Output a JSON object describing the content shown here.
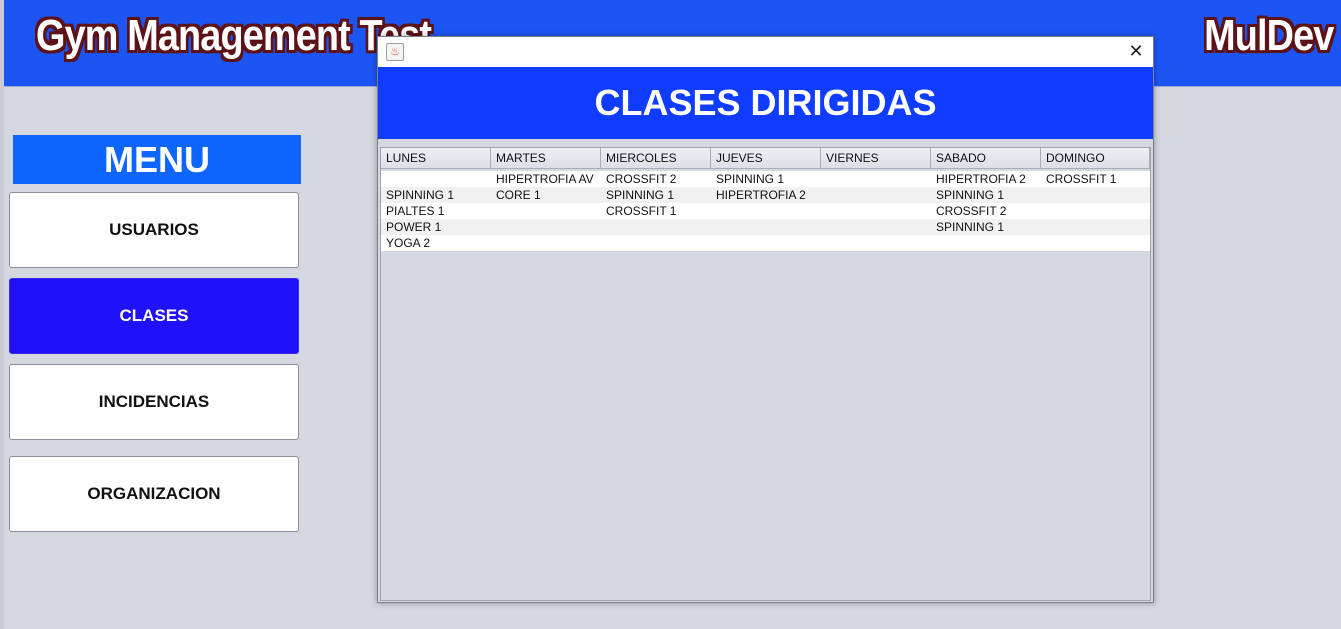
{
  "header": {
    "app_title": "Gym Management Test",
    "brand": "MulDev"
  },
  "sidebar": {
    "menu_title": "MENU",
    "items": [
      {
        "label": "USUARIOS",
        "active": false
      },
      {
        "label": "CLASES",
        "active": true
      },
      {
        "label": "INCIDENCIAS",
        "active": false
      },
      {
        "label": "ORGANIZACION",
        "active": false
      }
    ]
  },
  "dialog": {
    "window_icon": "java-icon",
    "close_glyph": "✕",
    "title": "CLASES DIRIGIDAS",
    "table": {
      "columns": [
        "LUNES",
        "MARTES",
        "MIERCOLES",
        "JUEVES",
        "VIERNES",
        "SABADO",
        "DOMINGO"
      ],
      "rows": [
        [
          "",
          "HIPERTROFIA AV",
          "CROSSFIT 2",
          "SPINNING 1",
          "",
          "HIPERTROFIA 2",
          "CROSSFIT 1"
        ],
        [
          "SPINNING 1",
          "CORE 1",
          "SPINNING 1",
          "HIPERTROFIA 2",
          "",
          "SPINNING 1",
          ""
        ],
        [
          "PIALTES 1",
          "",
          "CROSSFIT 1",
          "",
          "",
          "CROSSFIT 2",
          ""
        ],
        [
          "POWER 1",
          "",
          "",
          "",
          "",
          "SPINNING 1",
          ""
        ],
        [
          "YOGA 2",
          "",
          "",
          "",
          "",
          "",
          ""
        ]
      ]
    }
  },
  "colors": {
    "topbar": "#1d55f5",
    "menu_header": "#0f66ff",
    "active_button": "#1f12fa",
    "dialog_header": "#0f3cff",
    "background": "#d5d8e0"
  }
}
